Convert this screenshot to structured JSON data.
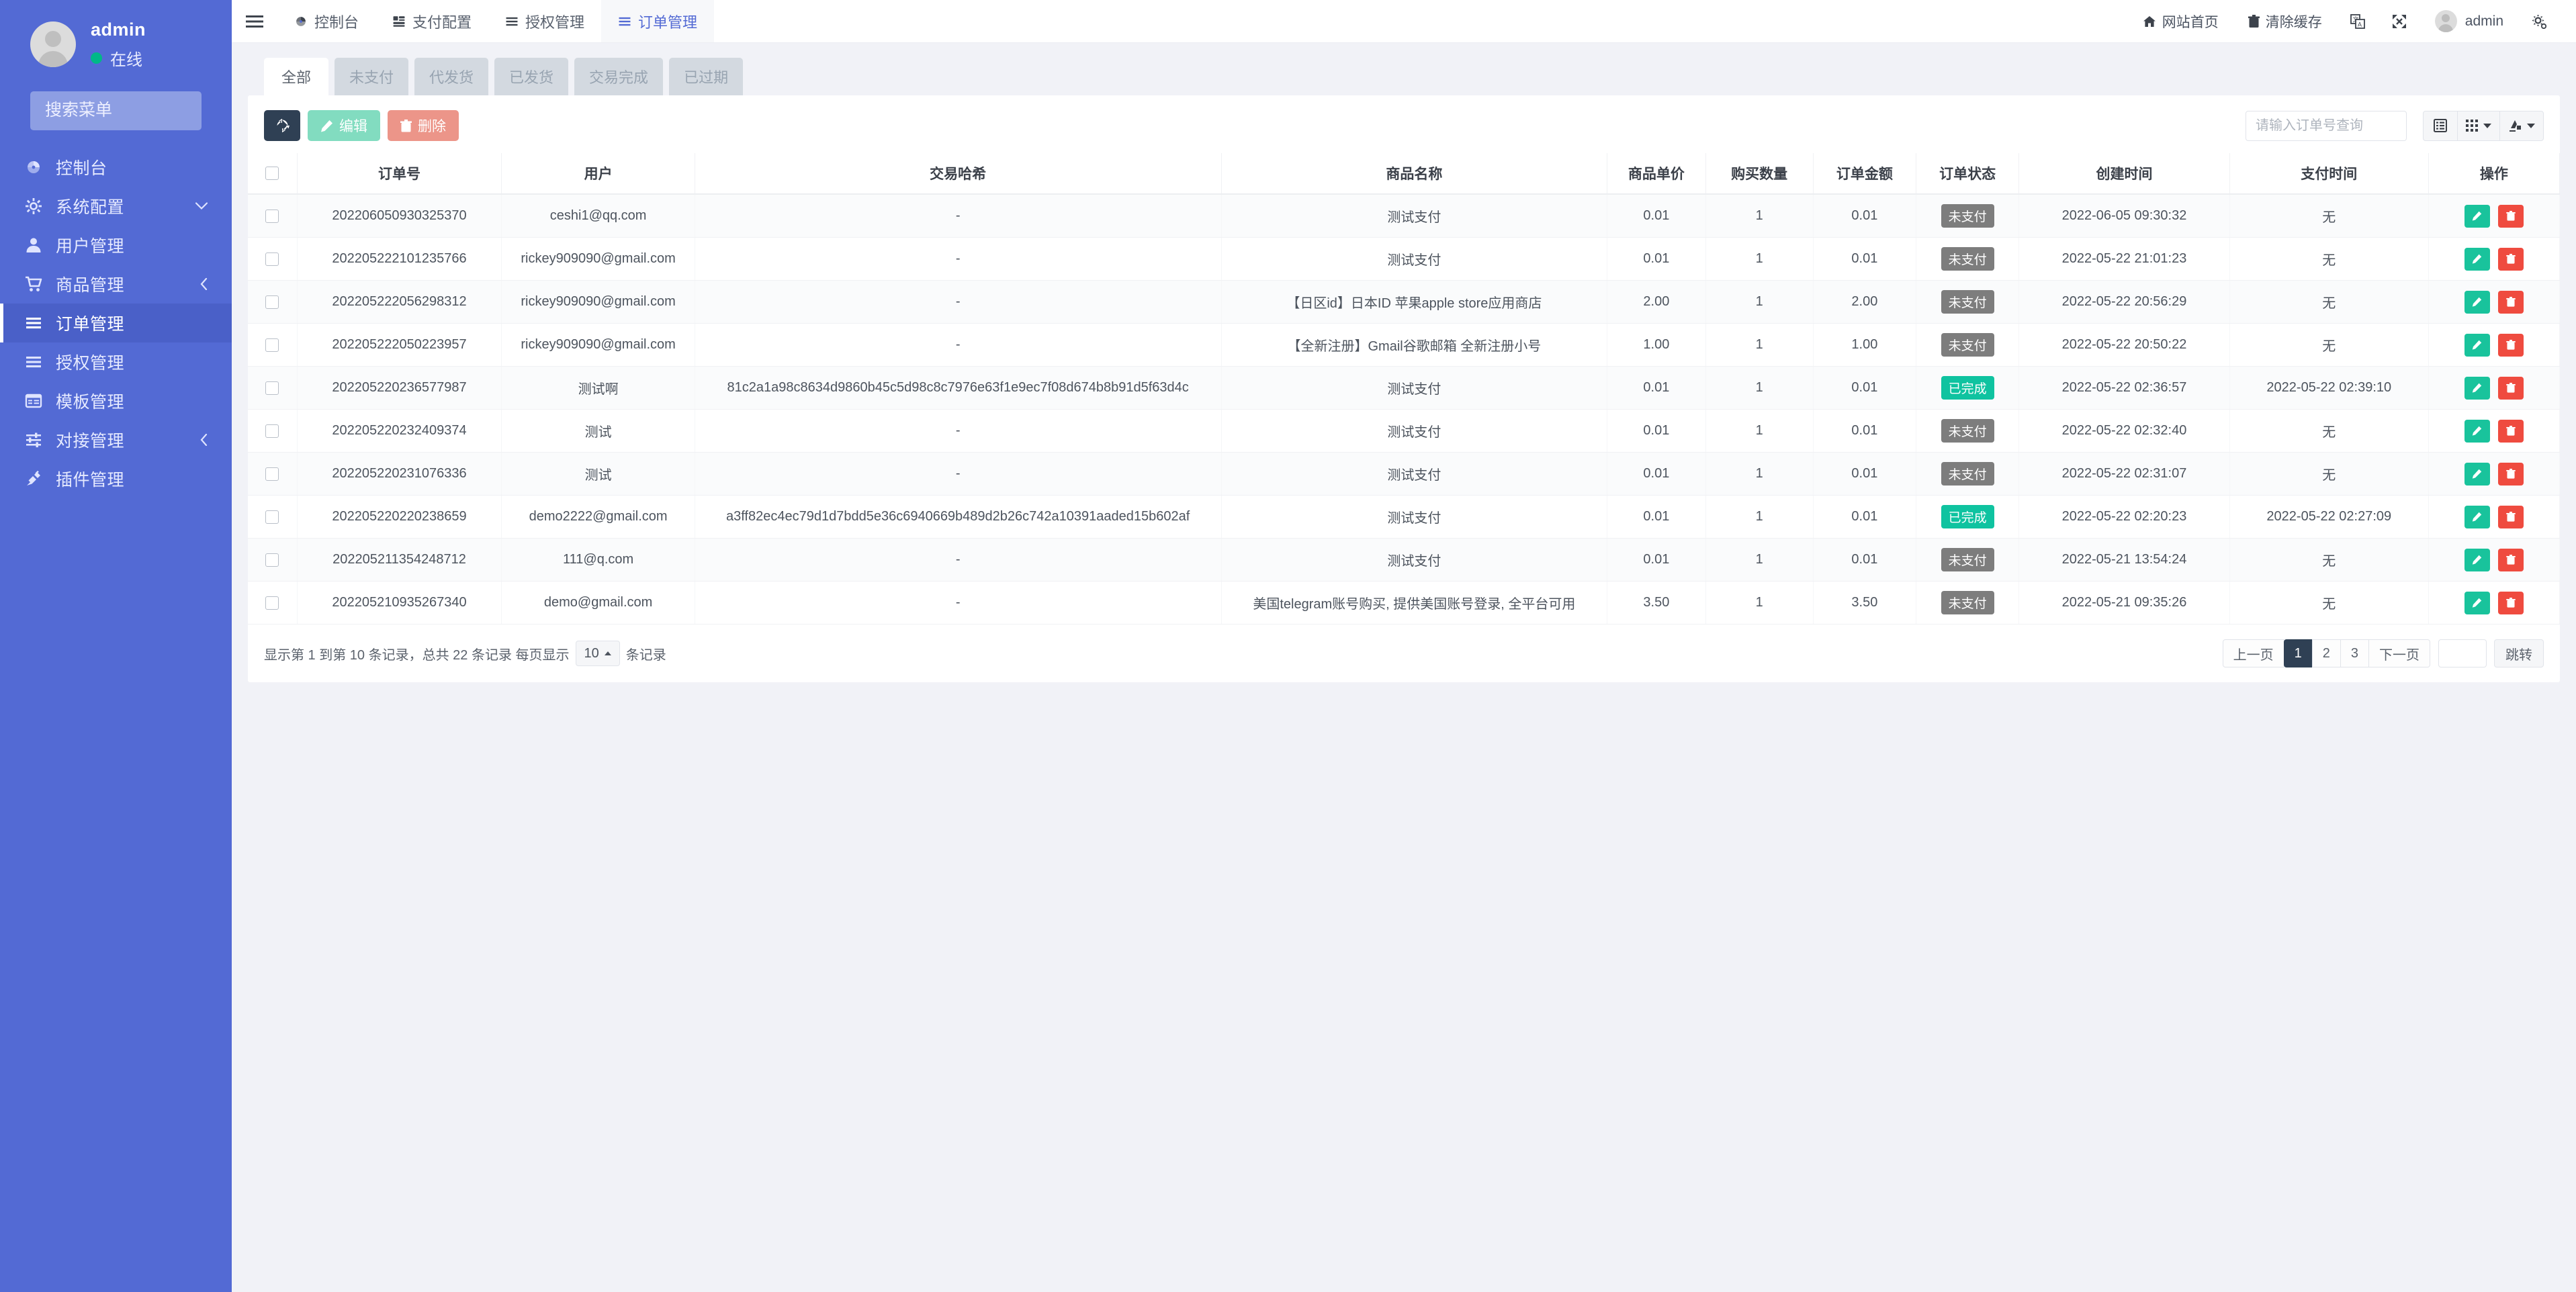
{
  "sidebar": {
    "user": {
      "name": "admin",
      "status": "在线",
      "status_color": "#00b887"
    },
    "search_placeholder": "搜索菜单",
    "items": [
      {
        "label": "控制台",
        "icon": "dashboard-icon",
        "arrow": "",
        "active": false
      },
      {
        "label": "系统配置",
        "icon": "gear-icon",
        "arrow": "down",
        "active": false
      },
      {
        "label": "用户管理",
        "icon": "user-icon",
        "arrow": "",
        "active": false
      },
      {
        "label": "商品管理",
        "icon": "cart-icon",
        "arrow": "left",
        "active": false
      },
      {
        "label": "订单管理",
        "icon": "list-icon",
        "arrow": "",
        "active": true
      },
      {
        "label": "授权管理",
        "icon": "list-icon",
        "arrow": "",
        "active": false
      },
      {
        "label": "模板管理",
        "icon": "window-icon",
        "arrow": "",
        "active": false
      },
      {
        "label": "对接管理",
        "icon": "sliders-icon",
        "arrow": "left",
        "active": false
      },
      {
        "label": "插件管理",
        "icon": "plug-icon",
        "arrow": "",
        "active": false
      }
    ]
  },
  "topbar": {
    "menu_toggle": "hamburger-icon",
    "tabs": [
      {
        "label": "控制台",
        "icon": "dashboard-icon",
        "active": false
      },
      {
        "label": "支付配置",
        "icon": "layout-icon",
        "active": false
      },
      {
        "label": "授权管理",
        "icon": "list-icon",
        "active": false
      },
      {
        "label": "订单管理",
        "icon": "list-icon",
        "active": true
      }
    ],
    "links": [
      {
        "label": "网站首页",
        "icon": "home-icon"
      },
      {
        "label": "清除缓存",
        "icon": "trash-icon"
      }
    ],
    "lang_icon": "language-icon",
    "fullscreen_icon": "fullscreen-icon",
    "user": "admin",
    "settings_icon": "gear-icon"
  },
  "filters": {
    "tabs": [
      {
        "label": "全部",
        "active": true
      },
      {
        "label": "未支付",
        "active": false
      },
      {
        "label": "代发货",
        "active": false
      },
      {
        "label": "已发货",
        "active": false
      },
      {
        "label": "交易完成",
        "active": false
      },
      {
        "label": "已过期",
        "active": false
      }
    ]
  },
  "toolbar": {
    "refresh_icon": "refresh-icon",
    "edit_label": "编辑",
    "edit_icon": "pencil-icon",
    "delete_label": "删除",
    "delete_icon": "trash-icon",
    "search_placeholder": "请输入订单号查询",
    "search_value": "",
    "tool_buttons": [
      {
        "icon": "columns-toggle-icon",
        "caret": false
      },
      {
        "icon": "grid-icon",
        "caret": true
      },
      {
        "icon": "export-icon",
        "caret": true
      }
    ]
  },
  "table": {
    "columns": [
      "",
      "订单号",
      "用户",
      "交易哈希",
      "商品名称",
      "商品单价",
      "购买数量",
      "订单金额",
      "订单状态",
      "创建时间",
      "支付时间",
      "操作"
    ],
    "rows": [
      {
        "order_no": "202206050930325370",
        "user": "ceshi1@qq.com",
        "hash": "-",
        "product": "测试支付",
        "price": "0.01",
        "qty": "1",
        "amount": "0.01",
        "status": "未支付",
        "status_type": "unpaid",
        "created": "2022-06-05 09:30:32",
        "paid": "无"
      },
      {
        "order_no": "202205222101235766",
        "user": "rickey909090@gmail.com",
        "hash": "-",
        "product": "测试支付",
        "price": "0.01",
        "qty": "1",
        "amount": "0.01",
        "status": "未支付",
        "status_type": "unpaid",
        "created": "2022-05-22 21:01:23",
        "paid": "无"
      },
      {
        "order_no": "202205222056298312",
        "user": "rickey909090@gmail.com",
        "hash": "-",
        "product": "【日区id】日本ID 苹果apple store应用商店",
        "price": "2.00",
        "qty": "1",
        "amount": "2.00",
        "status": "未支付",
        "status_type": "unpaid",
        "created": "2022-05-22 20:56:29",
        "paid": "无"
      },
      {
        "order_no": "202205222050223957",
        "user": "rickey909090@gmail.com",
        "hash": "-",
        "product": "【全新注册】Gmail谷歌邮箱 全新注册小号",
        "price": "1.00",
        "qty": "1",
        "amount": "1.00",
        "status": "未支付",
        "status_type": "unpaid",
        "created": "2022-05-22 20:50:22",
        "paid": "无"
      },
      {
        "order_no": "202205220236577987",
        "user": "测试啊",
        "hash": "81c2a1a98c8634d9860b45c5d98c8c7976e63f1e9ec7f08d674b8b91d5f63d4c",
        "product": "测试支付",
        "price": "0.01",
        "qty": "1",
        "amount": "0.01",
        "status": "已完成",
        "status_type": "done",
        "created": "2022-05-22 02:36:57",
        "paid": "2022-05-22 02:39:10"
      },
      {
        "order_no": "202205220232409374",
        "user": "测试",
        "hash": "-",
        "product": "测试支付",
        "price": "0.01",
        "qty": "1",
        "amount": "0.01",
        "status": "未支付",
        "status_type": "unpaid",
        "created": "2022-05-22 02:32:40",
        "paid": "无"
      },
      {
        "order_no": "202205220231076336",
        "user": "测试",
        "hash": "-",
        "product": "测试支付",
        "price": "0.01",
        "qty": "1",
        "amount": "0.01",
        "status": "未支付",
        "status_type": "unpaid",
        "created": "2022-05-22 02:31:07",
        "paid": "无"
      },
      {
        "order_no": "202205220220238659",
        "user": "demo2222@gmail.com",
        "hash": "a3ff82ec4ec79d1d7bdd5e36c6940669b489d2b26c742a10391aaded15b602af",
        "product": "测试支付",
        "price": "0.01",
        "qty": "1",
        "amount": "0.01",
        "status": "已完成",
        "status_type": "done",
        "created": "2022-05-22 02:20:23",
        "paid": "2022-05-22 02:27:09"
      },
      {
        "order_no": "202205211354248712",
        "user": "111@q.com",
        "hash": "-",
        "product": "测试支付",
        "price": "0.01",
        "qty": "1",
        "amount": "0.01",
        "status": "未支付",
        "status_type": "unpaid",
        "created": "2022-05-21 13:54:24",
        "paid": "无"
      },
      {
        "order_no": "202205210935267340",
        "user": "demo@gmail.com",
        "hash": "-",
        "product": "美国telegram账号购买, 提供美国账号登录, 全平台可用",
        "price": "3.50",
        "qty": "1",
        "amount": "3.50",
        "status": "未支付",
        "status_type": "unpaid",
        "created": "2022-05-21 09:35:26",
        "paid": "无"
      }
    ],
    "row_actions": {
      "edit_icon": "pencil-icon",
      "delete_icon": "trash-icon"
    }
  },
  "footer": {
    "info_prefix": "显示第 1 到第 10 条记录，总共 22 条记录 每页显示",
    "page_size": "10",
    "info_suffix": "条记录",
    "prev_label": "上一页",
    "pages": [
      "1",
      "2",
      "3"
    ],
    "current_page": "1",
    "next_label": "下一页",
    "jump_value": "",
    "jump_label": "跳转"
  }
}
